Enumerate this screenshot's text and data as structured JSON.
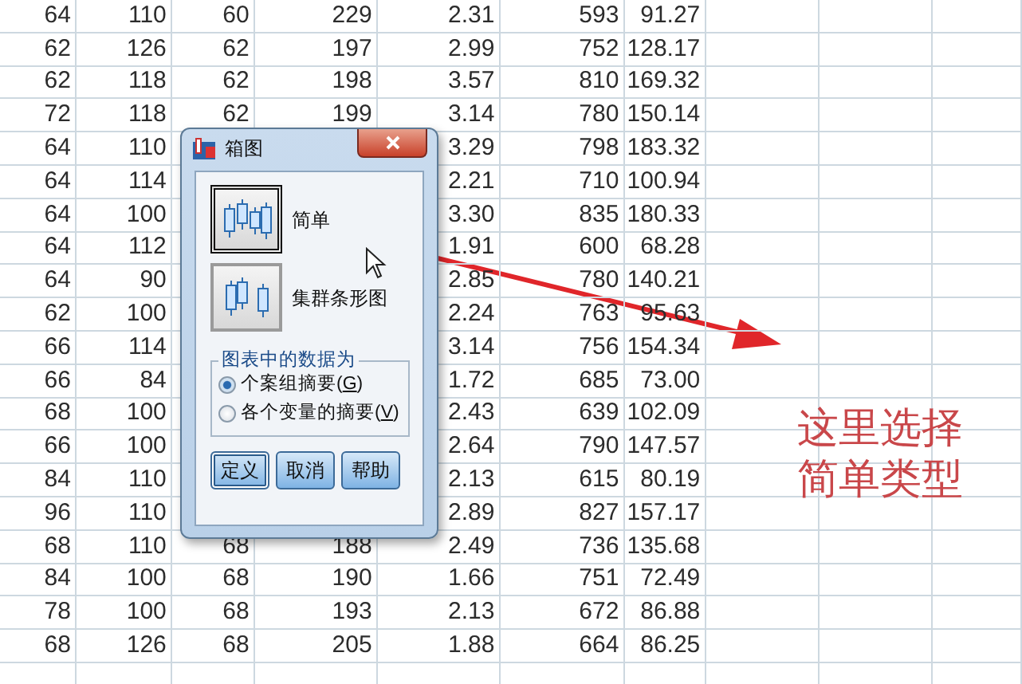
{
  "table": {
    "rows": [
      [
        "64",
        "110",
        "60",
        "229",
        "2.31",
        "593",
        "91.27"
      ],
      [
        "62",
        "126",
        "62",
        "197",
        "2.99",
        "752",
        "128.17"
      ],
      [
        "62",
        "118",
        "62",
        "198",
        "3.57",
        "810",
        "169.32"
      ],
      [
        "72",
        "118",
        "62",
        "199",
        "3.14",
        "780",
        "150.14"
      ],
      [
        "64",
        "110",
        null,
        null,
        "3.29",
        "798",
        "183.32"
      ],
      [
        "64",
        "114",
        null,
        null,
        "2.21",
        "710",
        "100.94"
      ],
      [
        "64",
        "100",
        null,
        null,
        "3.30",
        "835",
        "180.33"
      ],
      [
        "64",
        "112",
        null,
        null,
        "1.91",
        "600",
        "68.28"
      ],
      [
        "64",
        "90",
        null,
        null,
        "2.85",
        "780",
        "140.21"
      ],
      [
        "62",
        "100",
        null,
        null,
        "2.24",
        "763",
        "95.63"
      ],
      [
        "66",
        "114",
        null,
        null,
        "3.14",
        "756",
        "154.34"
      ],
      [
        "66",
        "84",
        null,
        null,
        "1.72",
        "685",
        "73.00"
      ],
      [
        "68",
        "100",
        null,
        null,
        "2.43",
        "639",
        "102.09"
      ],
      [
        "66",
        "100",
        null,
        null,
        "2.64",
        "790",
        "147.57"
      ],
      [
        "84",
        "110",
        null,
        null,
        "2.13",
        "615",
        "80.19"
      ],
      [
        "96",
        "110",
        null,
        null,
        "2.89",
        "827",
        "157.17"
      ],
      [
        "68",
        "110",
        "68",
        "188",
        "2.49",
        "736",
        "135.68"
      ],
      [
        "84",
        "100",
        "68",
        "190",
        "1.66",
        "751",
        "72.49"
      ],
      [
        "78",
        "100",
        "68",
        "193",
        "2.13",
        "672",
        "86.88"
      ],
      [
        "68",
        "126",
        "68",
        "205",
        "1.88",
        "664",
        "86.25"
      ]
    ]
  },
  "dialog": {
    "title": "箱图",
    "chart_types": [
      {
        "label": "简单",
        "kind": "simple",
        "selected": true
      },
      {
        "label": "集群条形图",
        "kind": "clustered",
        "selected": false
      }
    ],
    "group": {
      "title": "图表中的数据为",
      "options": [
        {
          "text": "个案组摘要(",
          "access_key": "G",
          "tail": ")",
          "selected": true
        },
        {
          "text": "各个变量的摘要(",
          "access_key": "V",
          "tail": ")",
          "selected": false
        }
      ]
    },
    "buttons": [
      {
        "label": "定义",
        "focused": true
      },
      {
        "label": "取消",
        "focused": false
      },
      {
        "label": "帮助",
        "focused": false
      }
    ]
  },
  "annotation": {
    "lines": [
      "这里选择",
      "简单类型"
    ]
  }
}
